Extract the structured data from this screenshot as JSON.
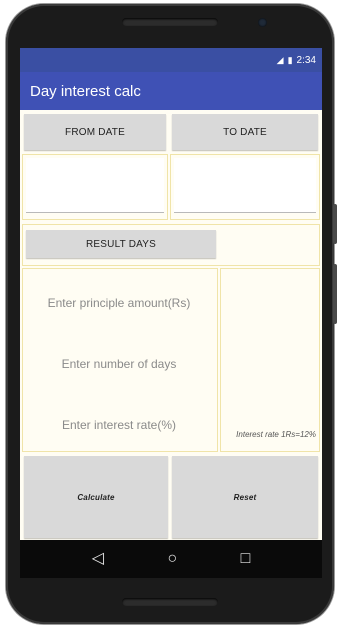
{
  "status_bar": {
    "time": "2:34",
    "signal_icon": "signal-icon",
    "battery_icon": "battery-icon"
  },
  "app_bar": {
    "title": "Day interest calc"
  },
  "date_section": {
    "from_label": "FROM DATE",
    "to_label": "TO DATE",
    "from_value": "",
    "to_value": ""
  },
  "result": {
    "label": "RESULT DAYS",
    "value": ""
  },
  "inputs": {
    "principle_placeholder": "Enter principle amount(Rs)",
    "days_placeholder": "Enter number of days",
    "rate_placeholder": "Enter interest rate(%)"
  },
  "note": "Interest rate 1Rs=12%",
  "actions": {
    "calculate_label": "Calculate",
    "reset_label": "Reset"
  },
  "nav": {
    "back_icon": "back-icon",
    "home_icon": "home-icon",
    "recents_icon": "recents-icon"
  },
  "colors": {
    "status_bar": "#3a4fa3",
    "app_bar": "#3f51b5",
    "button": "#d9d9d9",
    "content_bg": "#fffdf3"
  }
}
